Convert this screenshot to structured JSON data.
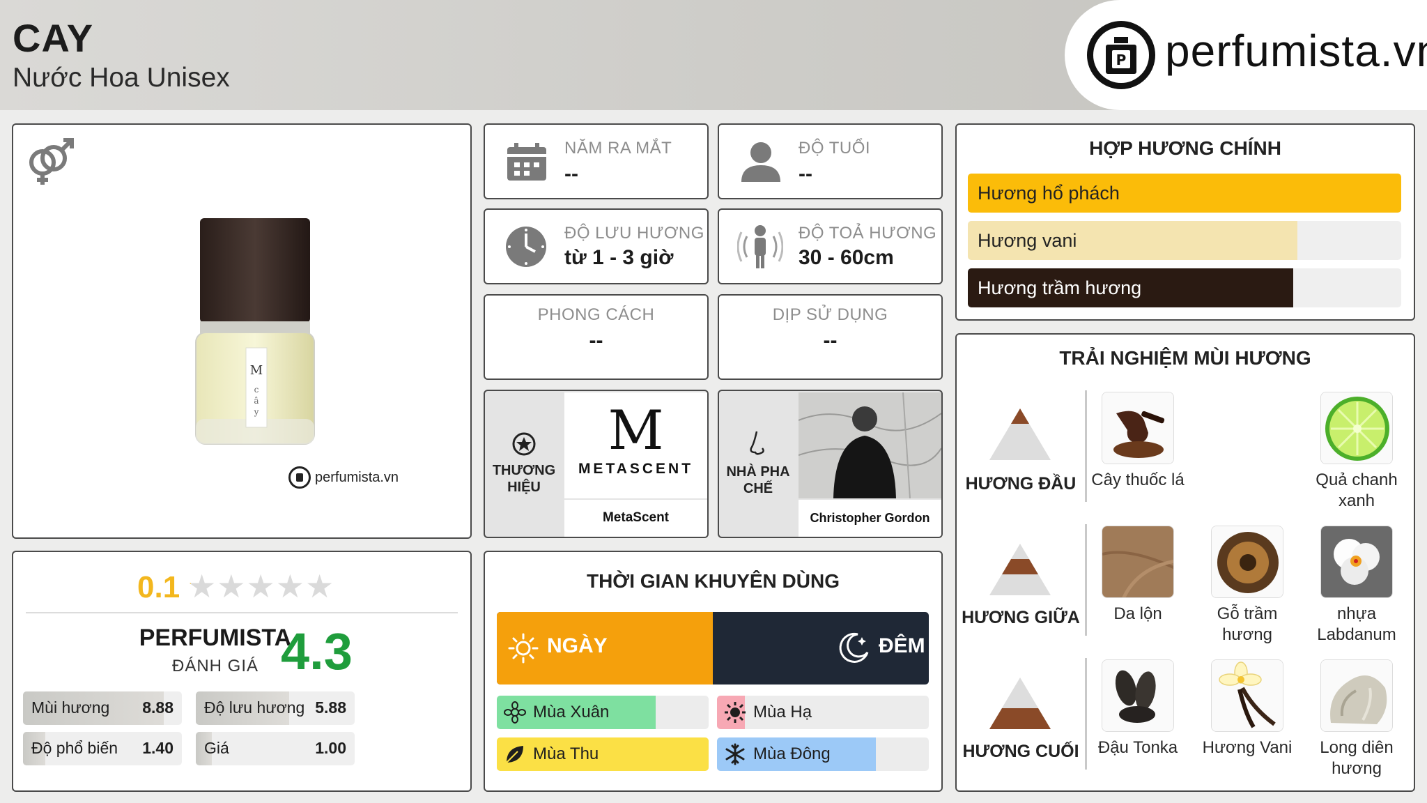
{
  "header": {
    "title": "CAY",
    "subtitle": "Nước Hoa Unisex",
    "logo_text": "perfumista.vn"
  },
  "product": {
    "watermark": "perfumista.vn",
    "bottle_label": "M\n—\nc\nâ\ny"
  },
  "info": {
    "year": {
      "label": "NĂM RA MẮT",
      "value": "--"
    },
    "age": {
      "label": "ĐỘ TUỔI",
      "value": "--"
    },
    "longevity": {
      "label": "ĐỘ LƯU HƯƠNG",
      "value": "từ 1 - 3 giờ"
    },
    "sillage": {
      "label": "ĐỘ TOẢ HƯƠNG",
      "value": "30 - 60cm"
    },
    "style": {
      "label": "PHONG CÁCH",
      "value": "--"
    },
    "occasion": {
      "label": "DỊP SỬ DỤNG",
      "value": "--"
    },
    "brand": {
      "label_1": "THƯƠNG",
      "label_2": "HIỆU",
      "logo_letter": "M",
      "logo_word": "METASCENT",
      "name": "MetaScent"
    },
    "perfumer": {
      "label_1": "NHÀ PHA",
      "label_2": "CHẾ",
      "name": "Christopher Gordon"
    }
  },
  "rating": {
    "user_score": "0.1",
    "user_stars": 0.02,
    "brand_word": "PERFUMISTA",
    "brand_sub": "ĐÁNH GIÁ",
    "score": "4.3",
    "metrics": [
      {
        "label": "Mùi hương",
        "value": "8.88",
        "fraction": 0.888
      },
      {
        "label": "Độ lưu hương",
        "value": "5.88",
        "fraction": 0.588
      },
      {
        "label": "Độ phổ biến",
        "value": "1.40",
        "fraction": 0.14
      },
      {
        "label": "Giá",
        "value": "1.00",
        "fraction": 0.1
      }
    ]
  },
  "time": {
    "title": "THỜI GIAN KHUYÊN DÙNG",
    "day": {
      "label": "NGÀY",
      "fraction": 0.5
    },
    "night": {
      "label": "ĐÊM"
    },
    "seasons": [
      {
        "label": "Mùa Xuân",
        "fraction": 0.75,
        "color": "#7ee0a0"
      },
      {
        "label": "Mùa Hạ",
        "fraction": 0.13,
        "color": "#f7a8b4"
      },
      {
        "label": "Mùa Thu",
        "fraction": 1.0,
        "color": "#fbe045"
      },
      {
        "label": "Mùa Đông",
        "fraction": 0.75,
        "color": "#9cc9f7"
      }
    ]
  },
  "accords": {
    "title": "HỢP HƯƠNG CHÍNH",
    "items": [
      {
        "label": "Hương hổ phách",
        "fraction": 1.0,
        "color": "#fbbc09",
        "text_color": "#222222"
      },
      {
        "label": "Hương vani",
        "fraction": 0.76,
        "color": "#f4e4b0",
        "text_color": "#222222"
      },
      {
        "label": "Hương trầm hương",
        "fraction": 0.75,
        "color": "#2a1a12",
        "text_color": "#ffffff"
      }
    ]
  },
  "notes": {
    "title": "TRẢI NGHIỆM MÙI HƯƠNG",
    "top": {
      "label": "HƯƠNG ĐẦU",
      "items": [
        "Cây thuốc lá",
        "Quả chanh\nxanh"
      ]
    },
    "middle": {
      "label": "HƯƠNG GIỮA",
      "items": [
        "Da lộn",
        "Gỗ trầm\nhương",
        "nhựa\nLabdanum"
      ]
    },
    "base": {
      "label": "HƯƠNG CUỐI",
      "items": [
        "Đậu Tonka",
        "Hương Vani",
        "Long diên\nhương"
      ]
    }
  },
  "colors": {
    "accent_orange": "#f5a00c",
    "night_navy": "#1f2836",
    "score_green": "#1f9d3c",
    "user_gold": "#f3b71e"
  }
}
